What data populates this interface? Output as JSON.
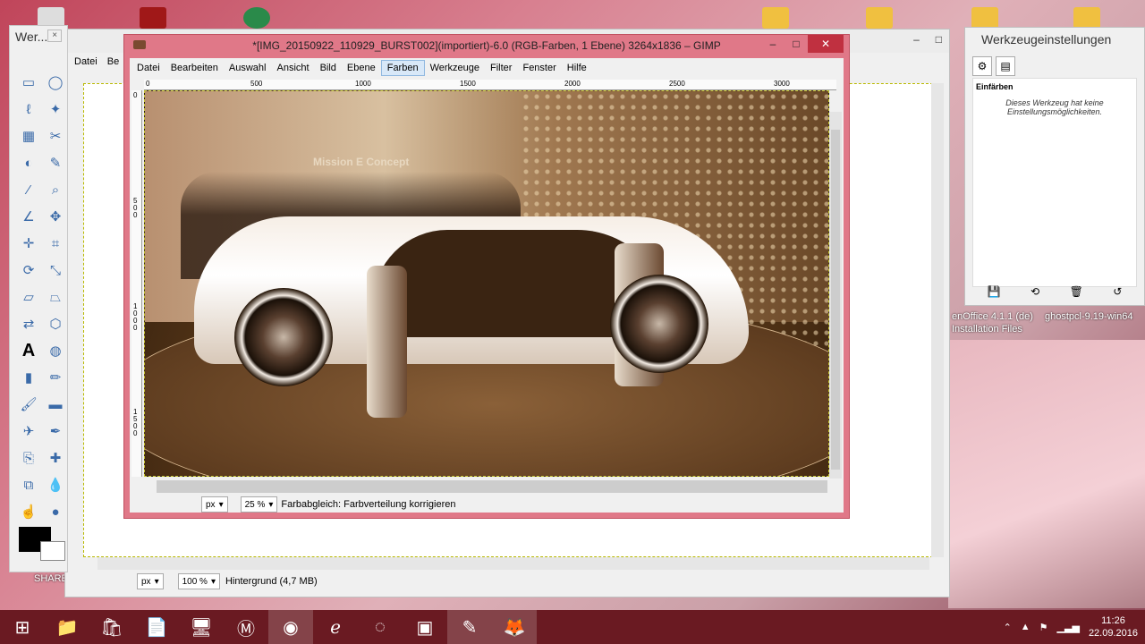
{
  "desktop": {
    "labels": [
      "enOffice 4.1.1 (de)",
      "Installation Files",
      "ghostpcl-9.19-win64",
      "SHARE"
    ]
  },
  "toolbox": {
    "title": "Wer...",
    "close": "×",
    "tools": [
      "rect-select",
      "ellipse-select",
      "free-select",
      "fuzzy-select",
      "color-select",
      "scissors-select",
      "foreground-select",
      "paths",
      "color-picker",
      "zoom",
      "measure",
      "move",
      "align",
      "crop",
      "rotate",
      "scale",
      "shear",
      "perspective",
      "flip",
      "cage",
      "text",
      "bucket-fill",
      "blend",
      "pencil",
      "paintbrush",
      "eraser",
      "airbrush",
      "ink",
      "clone",
      "heal",
      "perspective-clone",
      "blur",
      "smudge",
      "dodge"
    ]
  },
  "mainwin": {
    "menu": [
      "Datei",
      "Be"
    ],
    "zoom_unit": "px",
    "zoom": "100 %",
    "status": "Hintergrund (4,7 MB)"
  },
  "gimp": {
    "title": "*[IMG_20150922_110929_BURST002](importiert)-6.0 (RGB-Farben, 1 Ebene) 3264x1836 – GIMP",
    "menu": [
      "Datei",
      "Bearbeiten",
      "Auswahl",
      "Ansicht",
      "Bild",
      "Ebene",
      "Farben",
      "Werkzeuge",
      "Filter",
      "Fenster",
      "Hilfe"
    ],
    "active_menu": "Farben",
    "ruler_h": [
      "0",
      "500",
      "1000",
      "1500",
      "2000",
      "2500",
      "3000"
    ],
    "ruler_v": [
      "0",
      "500",
      "1000",
      "1500"
    ],
    "sign_text": "Mission E Concept",
    "unit": "px",
    "zoom": "25 %",
    "status": "Farbabgleich: Farbverteilung korrigieren"
  },
  "options": {
    "title": "Werkzeugeinstellungen",
    "tool": "Einfärben",
    "desc": "Dieses Werkzeug hat keine Einstellungsmöglichkeiten."
  },
  "taskbar": {
    "time": "11:26",
    "date": "22.09.2016"
  }
}
